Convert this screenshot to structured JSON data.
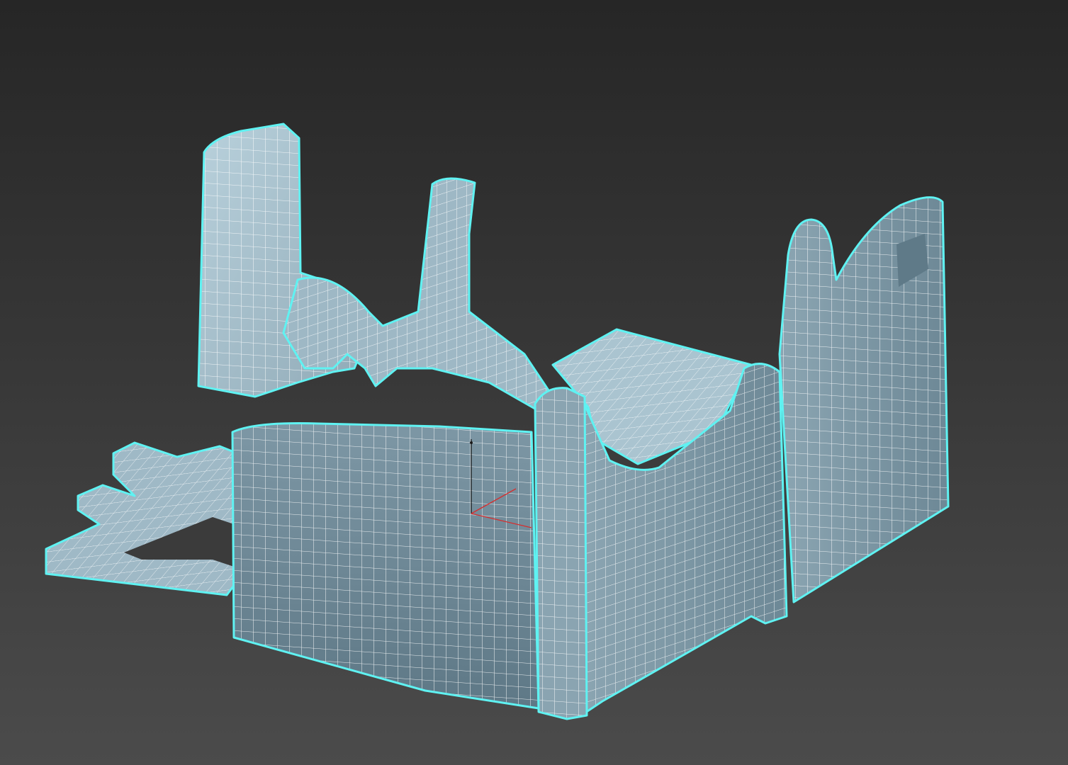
{
  "viewport": {
    "background_top": "#262626",
    "background_bottom": "#4b4b4b"
  },
  "model": {
    "selection_outline_color": "#5ff2f2",
    "wire_color": "#ffffff",
    "surface_light": "#a8c3cf",
    "surface_mid": "#7f9aa8",
    "surface_dark": "#5f7a88",
    "selected": true
  },
  "gizmo": {
    "axis_color": "#d43030",
    "pivot_color": "#1a1a1a"
  }
}
